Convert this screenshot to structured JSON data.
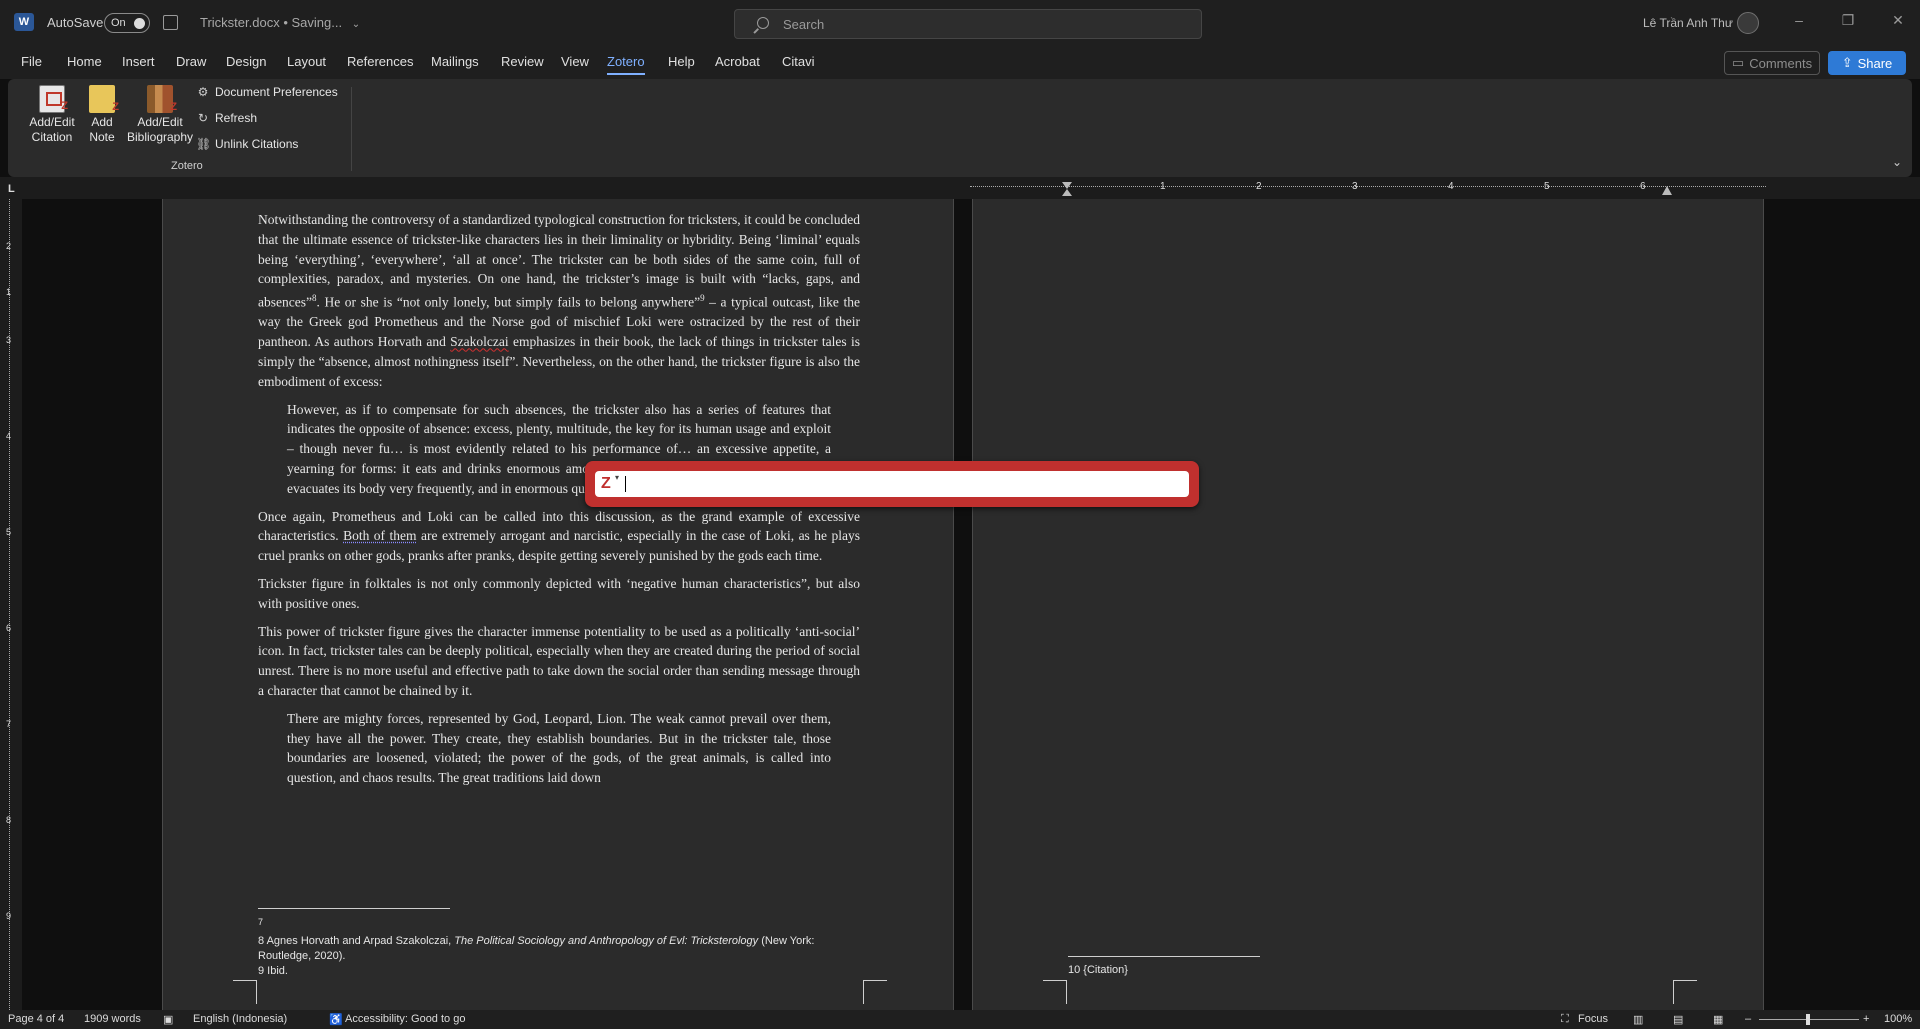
{
  "titlebar": {
    "app_icon": "W",
    "autosave_label": "AutoSave",
    "autosave_state": "On",
    "doc_title": "Trickster.docx",
    "save_state": "• Saving...",
    "search_placeholder": "Search",
    "username": "Lê Trần Anh Thư"
  },
  "menu": {
    "items": [
      "File",
      "Home",
      "Insert",
      "Draw",
      "Design",
      "Layout",
      "References",
      "Mailings",
      "Review",
      "View",
      "Zotero",
      "Help",
      "Acrobat",
      "Citavi"
    ],
    "active": "Zotero",
    "comments_label": "Comments",
    "share_label": "Share"
  },
  "ribbon": {
    "add_edit_citation": "Add/Edit\nCitation",
    "add_note": "Add\nNote",
    "add_edit_bibliography": "Add/Edit\nBibliography",
    "document_preferences": "Document Preferences",
    "refresh": "Refresh",
    "unlink_citations": "Unlink Citations",
    "group_label": "Zotero"
  },
  "ruler": {
    "corner": "L",
    "h_numbers": [
      "1",
      "2",
      "3",
      "4",
      "5",
      "6"
    ],
    "v_numbers": [
      "2",
      "1",
      "3",
      "4",
      "5",
      "6",
      "7",
      "8",
      "9"
    ]
  },
  "page1": {
    "para1_a": "Notwithstanding the controversy of a standardized typological construction for tricksters, it could be concluded that the ultimate essence of trickster-like characters lies in their liminality or hybridity. Being ‘liminal’ equals being ‘everything’, ‘everywhere’, ‘all at once’. The trickster can be both sides of the same coin, full of complexities, paradox, and mysteries. On one hand, the trickster’s image is built with “lacks, gaps, and absences”",
    "fn8": "8",
    "para1_b": ". He or she is “not only lonely, but simply fails to belong anywhere”",
    "fn9": "9",
    "para1_c": " – a typical outcast, like the way the Greek god Prometheus and the Norse god of mischief Loki were ostracized by the rest of their pantheon. As authors Horvath and ",
    "para1_squig": "Szakolczai",
    "para1_d": " emphasizes in their book, the lack of things in trickster tales is simply the “absence, almost nothingness itself”. Nevertheless, on the other hand, the trickster figure is also the embodiment of excess:",
    "quote1": "However, as if to compensate for such absences, the trickster also has a series of features that indicates the opposite of absence: excess, plenty, multitude, the key for its human usage and exploit – though never fu… is most evidently related to his performance of… an excessive appetite, a yearning for forms: it eats and drinks enormous amounts and – a logical consequence – it also evacuates its body very frequently, and in enormous quantities.",
    "para2_a": "Once again, Prometheus and Loki can be called into this discussion, as the grand example of excessive characteristics. ",
    "para2_squig": "Both of them",
    "para2_b": " are extremely arrogant and narcistic, especially in the case of Loki, as he plays cruel pranks on other gods, pranks after pranks, despite getting severely punished by the gods each time.",
    "para3": "Trickster figure in folktales is not only commonly depicted with ‘negative human characteristics”, but also with positive ones.",
    "para4": "This power of trickster figure gives the character immense potentiality to be used as a politically ‘anti-social’ icon. In fact, trickster tales can be deeply political, especially when they are created during the period of social unrest. There is no more useful and effective path to take down the social order than sending message through a character that cannot be chained by it.",
    "quote2": "There are mighty forces, represented by God, Leopard, Lion. The weak cannot prevail over them, they have all the power. They create, they establish boundaries. But in the trickster tale, those boundaries are loosened, violated; the power of the gods, of the great animals, is called into question, and chaos results. The great traditions laid down",
    "footnote7": "7",
    "footnote8_a": "8 Agnes Horvath and Arpad Szakolczai, ",
    "footnote8_title": "The Political Sociology and Anthropology of Evl: Tricksterology",
    "footnote8_b": " (New York: Routledge, 2020).",
    "footnote9": "9 Ibid."
  },
  "page2": {
    "footnote10": "10 {Citation}"
  },
  "statusbar": {
    "page": "Page 4 of 4",
    "words": "1909 words",
    "language": "English (Indonesia)",
    "accessibility": "Accessibility: Good to go",
    "focus": "Focus",
    "zoom": "100%"
  }
}
